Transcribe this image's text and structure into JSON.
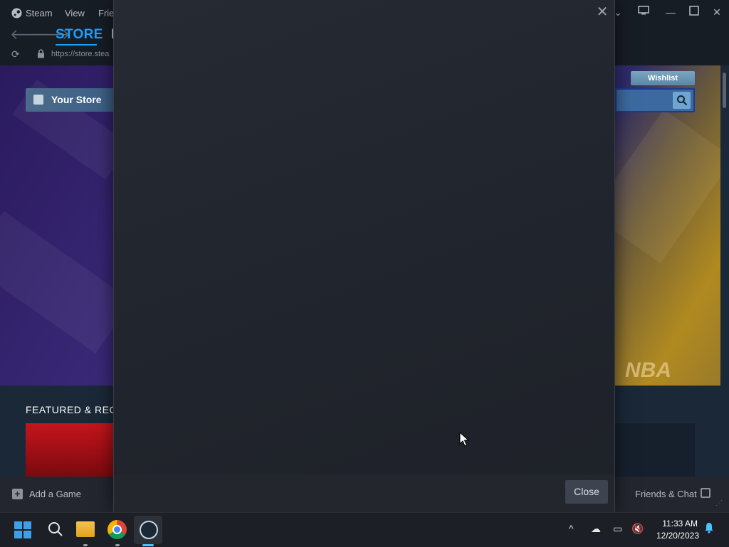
{
  "titlebar": {
    "menu": [
      "Steam",
      "View",
      "Frie"
    ]
  },
  "navbar": {
    "store_tab": "STORE",
    "library_tab_partial": "L",
    "url": "https://store.stea"
  },
  "store": {
    "your_store": "Your Store",
    "wishlist": "Wishlist",
    "featured_title": "FEATURED & RECO",
    "hero_text": "NBA"
  },
  "bottombar": {
    "add_game": "Add a Game",
    "friends_chat": "Friends & Chat"
  },
  "modal": {
    "close_button": "Close"
  },
  "taskbar": {
    "time": "11:33 AM",
    "date": "12/20/2023"
  },
  "colors": {
    "accent": "#1a9fff",
    "steam_dark": "#171d25",
    "modal_bg": "#23262d"
  }
}
